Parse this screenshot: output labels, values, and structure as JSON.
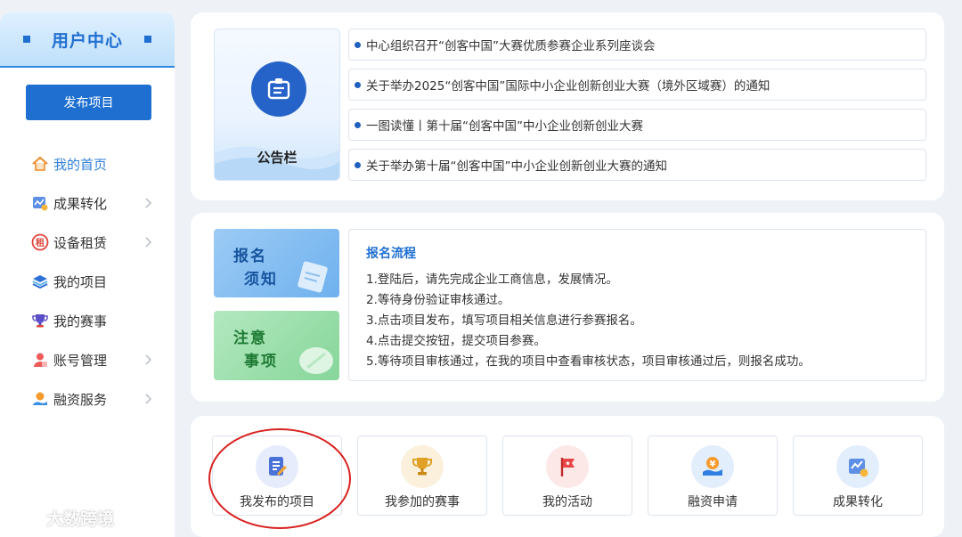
{
  "sidebar": {
    "title": "用户中心",
    "publish_button": "发布项目",
    "items": [
      {
        "label": "我的首页",
        "icon": "home-icon",
        "active": true,
        "has_arrow": false
      },
      {
        "label": "成果转化",
        "icon": "chart-icon",
        "active": false,
        "has_arrow": true
      },
      {
        "label": "设备租赁",
        "icon": "rent-icon",
        "active": false,
        "has_arrow": true
      },
      {
        "label": "我的项目",
        "icon": "layers-icon",
        "active": false,
        "has_arrow": false
      },
      {
        "label": "我的赛事",
        "icon": "trophy-icon",
        "active": false,
        "has_arrow": false
      },
      {
        "label": "账号管理",
        "icon": "user-icon",
        "active": false,
        "has_arrow": true
      },
      {
        "label": "融资服务",
        "icon": "finance-icon",
        "active": false,
        "has_arrow": true
      }
    ]
  },
  "notice": {
    "board_label": "公告栏",
    "items": [
      "中心组织召开“创客中国”大赛优质参赛企业系列座谈会",
      "关于举办2025“创客中国”国际中小企业创新创业大赛（境外区域赛）的通知",
      "一图读懂丨第十届“创客中国”中小企业创新创业大赛",
      "关于举办第十届“创客中国”中小企业创新创业大赛的通知"
    ]
  },
  "tiles": {
    "registration": {
      "line1": "报名",
      "line2": "须知"
    },
    "attention": {
      "line1": "注意",
      "line2": "事项"
    }
  },
  "flow": {
    "title": "报名流程",
    "steps": [
      "1.登陆后，请先完成企业工商信息，发展情况。",
      "2.等待身份验证审核通过。",
      "3.点击项目发布，填写项目相关信息进行参赛报名。",
      "4.点击提交按钮，提交项目参赛。",
      "5.等待项目审核通过，在我的项目中查看审核状态，项目审核通过后，则报名成功。"
    ]
  },
  "quick_links": [
    {
      "label": "我发布的项目",
      "icon": "document-icon",
      "bg": "#e6ecfb"
    },
    {
      "label": "我参加的赛事",
      "icon": "trophy-icon",
      "bg": "#fbf0dc"
    },
    {
      "label": "我的活动",
      "icon": "flag-icon",
      "bg": "#fde8e8"
    },
    {
      "label": "融资申请",
      "icon": "yuan-hand-icon",
      "bg": "#e3eefc"
    },
    {
      "label": "成果转化",
      "icon": "result-icon",
      "bg": "#e3eefc"
    }
  ],
  "watermark": "大数跨境",
  "colors": {
    "accent": "#1f6fd1",
    "highlight": "#d9211f"
  }
}
